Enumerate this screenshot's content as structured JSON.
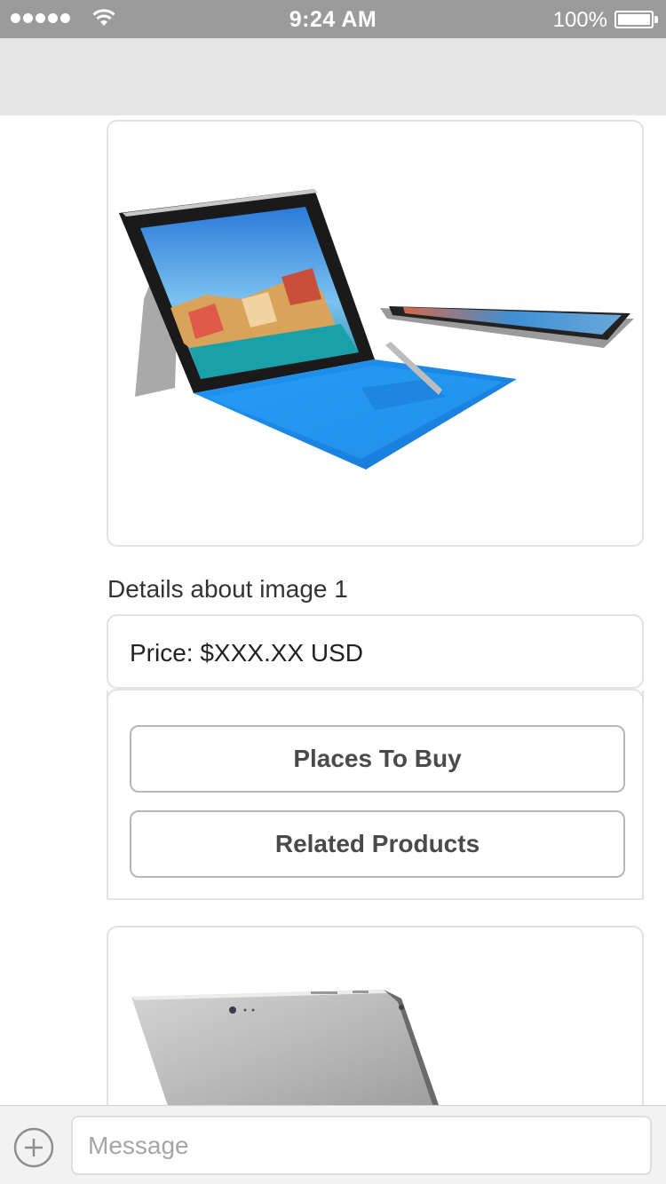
{
  "status_bar": {
    "time": "9:24 AM",
    "battery": "100%"
  },
  "icons": {
    "signal": "signal-dots-icon",
    "wifi": "wifi-icon",
    "battery": "battery-icon",
    "add": "plus-circle-icon",
    "image_1": "surface-laptop-image",
    "image_2": "surface-tablet-back-image"
  },
  "message": {
    "caption": "Details about image 1",
    "price": "Price: $XXX.XX USD",
    "buttons": [
      {
        "label": "Places To Buy"
      },
      {
        "label": "Related Products"
      }
    ]
  },
  "composer": {
    "placeholder": "Message"
  },
  "colors": {
    "status_bar": "#9b9b9b",
    "nav_bar": "#e6e6e6",
    "keyboard_blue": "#1e8ff0",
    "device_silver": "#b8b8b8"
  }
}
